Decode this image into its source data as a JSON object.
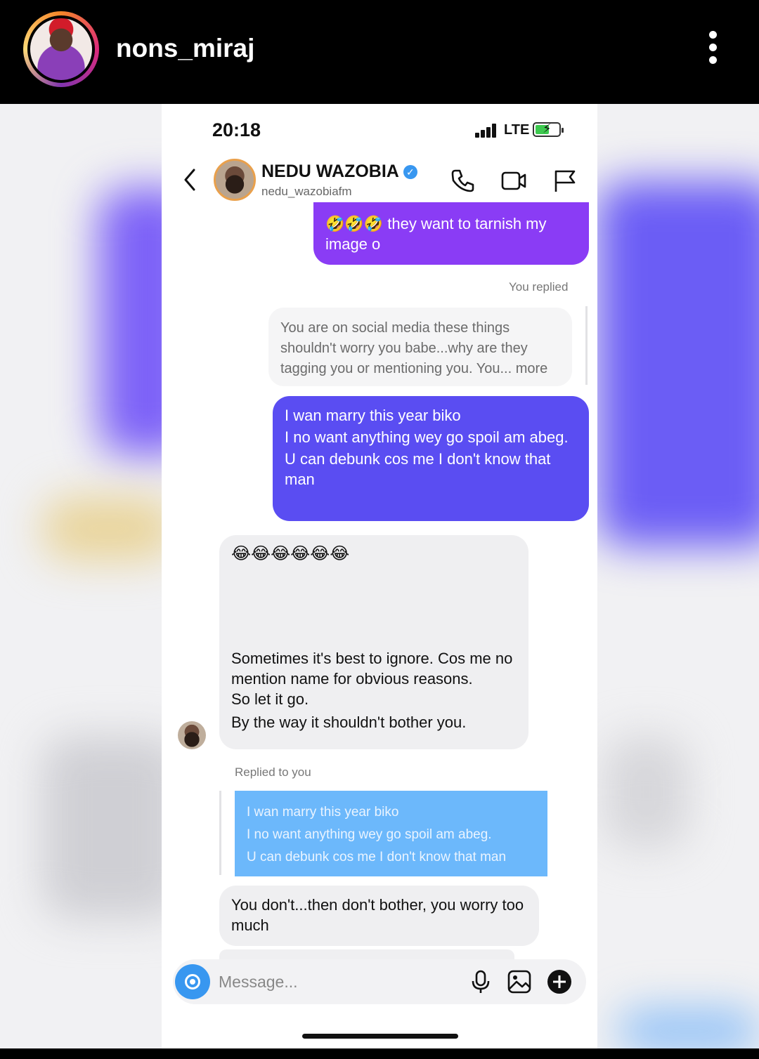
{
  "story": {
    "username": "nons_miraj"
  },
  "phone": {
    "status_time": "20:18",
    "network": "LTE",
    "chat_name": "NEDU WAZOBIA",
    "chat_handle": "nedu_wazobiafm",
    "messages": {
      "m1_emoji": "🤣🤣🤣",
      "m1_text": " they want to tarnish my image o",
      "you_replied": "You replied",
      "quoted_reply": "You are on social media these things shouldn't worry you babe...why are they tagging you or mentioning you. You... more",
      "m2_line1": "I wan marry this year biko",
      "m2_line2": "I no want anything wey go spoil am abeg.",
      "m2_line3": "U can debunk cos me I don't know that man",
      "m3_emoji": "😂😂😂😂😂😂",
      "m3_line1": "Sometimes it's best to ignore. Cos me no mention name for obvious reasons.",
      "m3_line2": "So let it go.",
      "m3_line3": "By the way it shouldn't bother you.",
      "replied_to_you": "Replied to you",
      "quoted_line1": "I wan marry this year biko",
      "quoted_line2": "I no want anything wey go spoil am abeg.",
      "quoted_line3": "U can debunk cos me I don't know that man",
      "m4_text": "You don't...then don't bother, you worry too much"
    },
    "composer": {
      "placeholder": "Message..."
    }
  },
  "colors": {
    "bubble_purple": "#8a3cf5",
    "bubble_indigo": "#5a4df2",
    "bubble_light_blue": "#6cb8fb",
    "verified_blue": "#3897f0"
  }
}
